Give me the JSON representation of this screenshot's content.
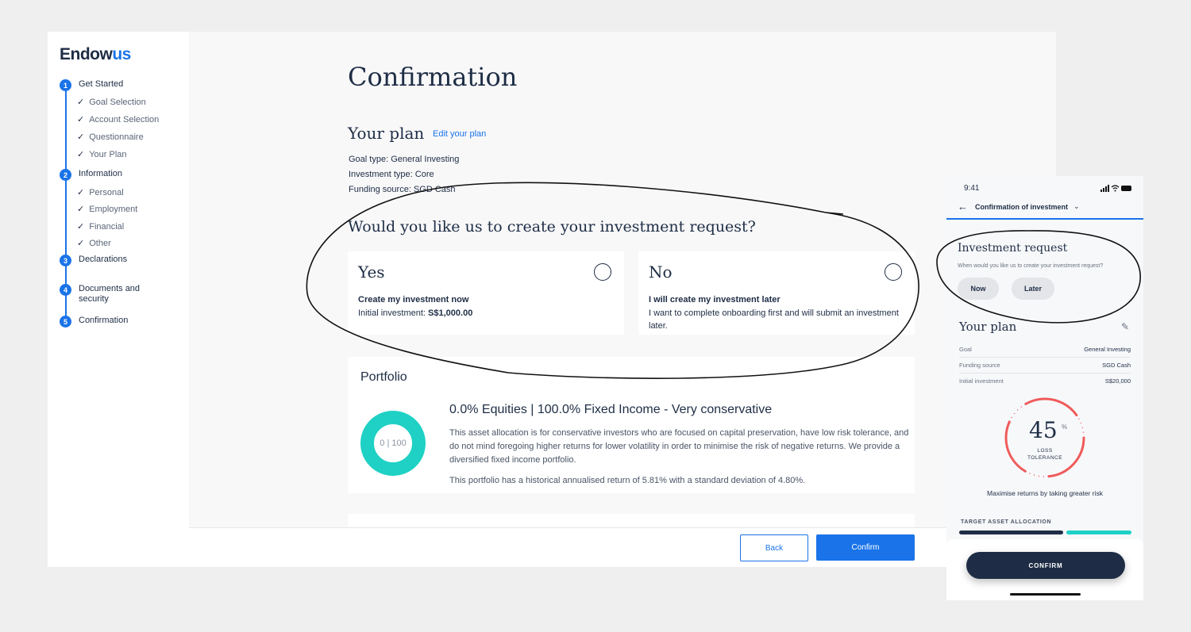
{
  "brand": {
    "name_a": "Endow",
    "name_b": "us",
    "accent": "#1a73e8"
  },
  "sidebar": {
    "steps": [
      {
        "num": "1",
        "label": "Get Started",
        "subs": [
          "Goal Selection",
          "Account Selection",
          "Questionnaire",
          "Your Plan"
        ]
      },
      {
        "num": "2",
        "label": "Information",
        "subs": [
          "Personal",
          "Employment",
          "Financial",
          "Other"
        ]
      },
      {
        "num": "3",
        "label": "Declarations"
      },
      {
        "num": "4",
        "label": "Documents and security"
      },
      {
        "num": "5",
        "label": "Confirmation"
      }
    ]
  },
  "main": {
    "title": "Confirmation",
    "plan_heading": "Your plan",
    "edit_link": "Edit your plan",
    "meta": [
      "Goal type: General Investing",
      "Investment type: Core",
      "Funding source: SGD Cash"
    ],
    "question": "Would you like us to create your investment request?",
    "yes": {
      "title": "Yes",
      "bold": "Create my investment now",
      "desc_prefix": "Initial investment: ",
      "amount": "S$1,000.00"
    },
    "no": {
      "title": "No",
      "bold": "I will create my investment later",
      "desc": "I want to complete onboarding first and will submit an investment later."
    },
    "portfolio": {
      "heading": "Portfolio",
      "donut_label": "0 | 100",
      "equities_pct": 0,
      "fixed_income_pct": 100,
      "title": "0.0% Equities | 100.0% Fixed Income - Very conservative",
      "desc": "This asset allocation is for conservative investors who are focused on capital preservation, have low risk tolerance, and do not mind foregoing higher returns for lower volatility in order to minimise the risk of negative returns. We provide a diversified fixed income portfolio.",
      "stats": "This portfolio has a historical annualised return of 5.81% with a standard deviation of 4.80%."
    },
    "back": "Back",
    "confirm": "Confirm"
  },
  "phone": {
    "time": "9:41",
    "nav_title": "Confirmation of investment",
    "req_title": "Investment request",
    "req_q": "When would you like us to create your investment request?",
    "now": "Now",
    "later": "Later",
    "plan_title": "Your plan",
    "rows": [
      [
        "Goal",
        "General Investing"
      ],
      [
        "Funding source",
        "SGD Cash"
      ],
      [
        "Initial investment",
        "S$20,000"
      ]
    ],
    "loss_value": "45",
    "loss_unit": "%",
    "loss_label1": "LOSS",
    "loss_label2": "TOLERANCE",
    "loss_pct": 45,
    "risk_text": "Maximise returns by taking greater risk",
    "alloc_label": "TARGET ASSET ALLOCATION",
    "confirm": "CONFIRM"
  },
  "colors": {
    "teal": "#1ed1c4",
    "navy": "#1e2d45",
    "red": "#f05a5a"
  }
}
